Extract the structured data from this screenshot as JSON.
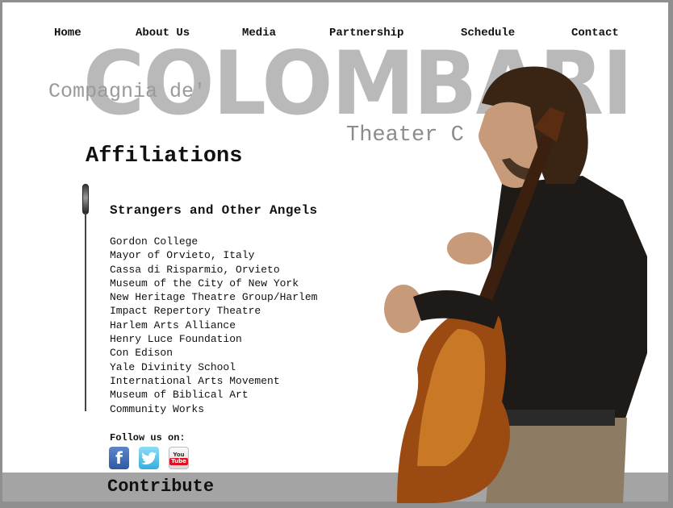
{
  "nav": {
    "home": "Home",
    "about": "About Us",
    "media": "Media",
    "partnership": "Partnership",
    "schedule": "Schedule",
    "contact": "Contact"
  },
  "brand": {
    "big": "COLOMBARI",
    "sub1": "Compagnia de'",
    "sub2": "Theater C"
  },
  "main": {
    "heading": "Affiliations",
    "subheading": "Strangers and Other Angels",
    "affiliations": [
      "Gordon College",
      "Mayor of Orvieto, Italy",
      "Cassa di Risparmio, Orvieto",
      "Museum of the City of New York",
      "New Heritage Theatre Group/Harlem",
      "Impact Repertory Theatre",
      "Harlem Arts Alliance",
      "Henry Luce Foundation",
      "Con Edison",
      "Yale Divinity School",
      "International Arts Movement",
      "Museum of Biblical Art",
      "Community Works"
    ]
  },
  "social": {
    "follow_label": "Follow us on:",
    "facebook_glyph": "f",
    "youtube_top": "You",
    "youtube_bottom": "Tube"
  },
  "footer": {
    "contribute": "Contribute"
  },
  "colors": {
    "background": "#8f8f8f",
    "page": "#ffffff",
    "footer_bar": "#a4a4a4",
    "brand_text": "#b9b9b9"
  }
}
